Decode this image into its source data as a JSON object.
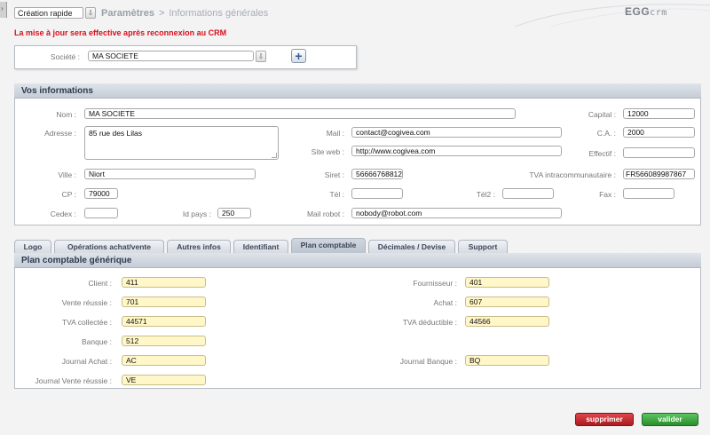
{
  "topbar": {
    "quick_create": "Création rapide",
    "crumb_section": "Paramètres",
    "crumb_separator": ">",
    "crumb_page": "Informations générales",
    "logo_main": "EGG",
    "logo_sub": "crm"
  },
  "warning": "La mise à jour sera effective après reconnexion au CRM",
  "societe": {
    "label": "Société :",
    "value": "MA SOCIETE"
  },
  "vos": {
    "title": "Vos informations",
    "nom": {
      "label": "Nom :",
      "value": "MA SOCIETE"
    },
    "adresse": {
      "label": "Adresse :",
      "value": "85 rue des Lilas"
    },
    "ville": {
      "label": "Ville :",
      "value": "Niort"
    },
    "cp": {
      "label": "CP :",
      "value": "79000"
    },
    "cedex": {
      "label": "Cedex :",
      "value": ""
    },
    "idpays": {
      "label": "Id pays :",
      "value": "250"
    },
    "mail": {
      "label": "Mail :",
      "value": "contact@cogivea.com"
    },
    "site": {
      "label": "Site web :",
      "value": "http://www.cogivea.com"
    },
    "siret": {
      "label": "Siret :",
      "value": "56666768812"
    },
    "tel": {
      "label": "Tél :",
      "value": ""
    },
    "tel2": {
      "label": "Tél2 :",
      "value": ""
    },
    "mailrobot": {
      "label": "Mail robot :",
      "value": "nobody@robot.com"
    },
    "capital": {
      "label": "Capital :",
      "value": "12000"
    },
    "ca": {
      "label": "C.A. :",
      "value": "2000"
    },
    "effectif": {
      "label": "Effectif :",
      "value": ""
    },
    "tva_intra": {
      "label": "TVA intracommunautaire :",
      "value": "FR566089987867"
    },
    "fax": {
      "label": "Fax :",
      "value": ""
    }
  },
  "tabs": [
    {
      "label": "Logo"
    },
    {
      "label": "Opérations achat/vente"
    },
    {
      "label": "Autres infos"
    },
    {
      "label": "Identifiant"
    },
    {
      "label": "Plan comptable"
    },
    {
      "label": "Décimales / Devise"
    },
    {
      "label": "Support"
    }
  ],
  "active_tab": "Plan comptable",
  "plan": {
    "title": "Plan comptable générique",
    "client": {
      "label": "Client :",
      "value": "411"
    },
    "vente": {
      "label": "Vente réussie :",
      "value": "701"
    },
    "tva_col": {
      "label": "TVA collectée :",
      "value": "44571"
    },
    "banque": {
      "label": "Banque :",
      "value": "512"
    },
    "journal_achat": {
      "label": "Journal Achat :",
      "value": "AC"
    },
    "journal_vente": {
      "label": "Journal Vente réussie :",
      "value": "VE"
    },
    "fournisseur": {
      "label": "Fournisseur :",
      "value": "401"
    },
    "achat": {
      "label": "Achat :",
      "value": "607"
    },
    "tva_ded": {
      "label": "TVA déductible :",
      "value": "44566"
    },
    "journal_banque": {
      "label": "Journal Banque :",
      "value": "BQ"
    }
  },
  "buttons": {
    "delete": "supprimer",
    "validate": "valider"
  },
  "colors": {
    "warning": "#d8101d",
    "delete": "#c0262c",
    "validate": "#3aa83d",
    "highlight_field": "#fff7c8"
  }
}
